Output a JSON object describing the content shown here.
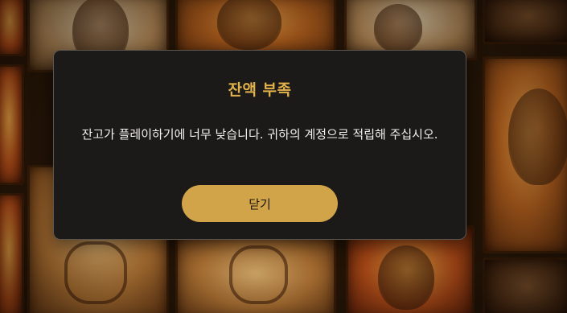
{
  "modal": {
    "title": "잔액 부족",
    "message": "잔고가 플레이하기에 너무 낮습니다. 귀하의 계정으로 적립해 주십시오.",
    "close_label": "닫기"
  },
  "colors": {
    "title_accent": "#e2b24a",
    "button_bg": "#d1a44a",
    "modal_bg": "#1c1a19",
    "text": "#f2f0ec"
  }
}
